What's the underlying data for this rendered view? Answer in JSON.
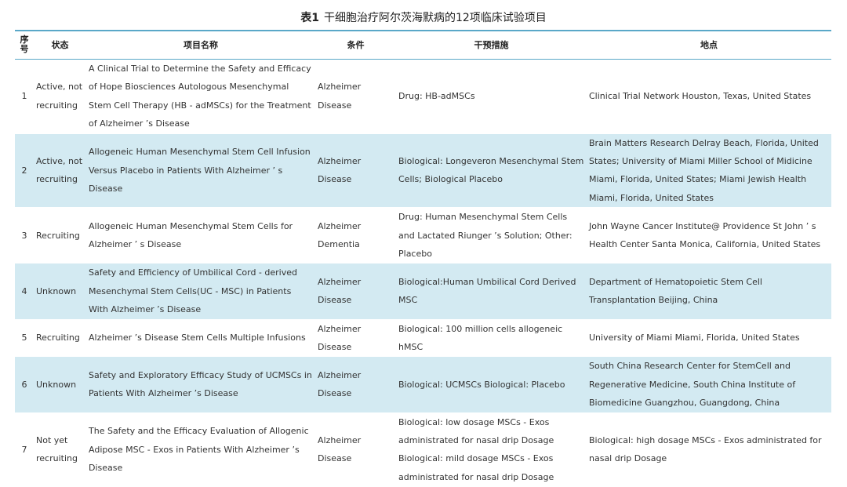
{
  "caption": {
    "label": "表1",
    "title": "干细胞治疗阿尔茨海默病的12项临床试验项目"
  },
  "table": {
    "headers": {
      "seq": "序号",
      "status": "状态",
      "name": "项目名称",
      "condition": "条件",
      "intervention": "干预措施",
      "location": "地点"
    },
    "rows": [
      {
        "seq": "1",
        "status": "Active, not recruiting",
        "name": "A Clinical Trial to Determine the Safety and Efficacy of Hope Biosciences Autologous Mesenchymal Stem Cell Therapy (HB - adMSCs) for the Treatment of Alzheimer ’s Disease",
        "condition": "Alzheimer Disease",
        "intervention": "Drug: HB-adMSCs",
        "location": "Clinical Trial Network Houston, Texas, United States"
      },
      {
        "seq": "2",
        "status": "Active, not recruiting",
        "name": "Allogeneic Human Mesenchymal Stem Cell Infusion Versus Placebo in Patients With Alzheimer ’ s Disease",
        "condition": "Alzheimer Disease",
        "intervention": "Biological: Longeveron Mesenchymal Stem Cells; Biological Placebo",
        "location": "Brain Matters Research Delray Beach, Florida, United States; University of Miami Miller School of Midicine Miami, Florida, United States; Miami Jewish Health Miami, Florida, United States"
      },
      {
        "seq": "3",
        "status": "Recruiting",
        "name": "Allogeneic Human Mesenchymal Stem Cells for Alzheimer ’ s Disease",
        "condition": "Alzheimer Dementia",
        "intervention": "Drug: Human Mesenchymal Stem Cells and Lactated Riunger ’s Solution; Other: Placebo",
        "location": "John Wayne Cancer Institute@ Providence St John ’ s Health Center Santa Monica, California, United States"
      },
      {
        "seq": "4",
        "status": "Unknown",
        "name": "Safety and Efficiency of Umbilical Cord - derived Mesenchymal Stem Cells(UC - MSC) in Patients With Alzheimer ’s Disease",
        "condition": "Alzheimer Disease",
        "intervention": "Biological:Human Umbilical Cord Derived MSC",
        "location": "Department of Hematopoietic Stem Cell Transplantation Beijing, China"
      },
      {
        "seq": "5",
        "status": "Recruiting",
        "name": "Alzheimer ’s Disease Stem Cells Multiple Infusions",
        "condition": "Alzheimer Disease",
        "intervention": "Biological: 100 million cells allogeneic hMSC",
        "location": "University of Miami Miami, Florida, United States"
      },
      {
        "seq": "6",
        "status": "Unknown",
        "name": "Safety and Exploratory Efficacy Study of UCMSCs in Patients With Alzheimer ’s Disease",
        "condition": "Alzheimer Disease",
        "intervention": "Biological: UCMSCs Biological: Placebo",
        "location": "South China Research Center for StemCell and Regenerative Medicine, South China Institute of Biomedicine Guangzhou, Guangdong, China"
      },
      {
        "seq": "7",
        "status": "Not yet recruiting",
        "name": "The Safety and the Efficacy Evaluation of Allogenic Adipose MSC - Exos in Patients With Alzheimer ’s Disease",
        "condition": "Alzheimer Disease",
        "intervention": "Biological: low dosage MSCs - Exos administrated for nasal drip Dosage Biological: mild dosage MSCs - Exos administrated for nasal drip Dosage",
        "location": "Biological: high dosage MSCs - Exos administrated for nasal drip Dosage"
      }
    ]
  }
}
